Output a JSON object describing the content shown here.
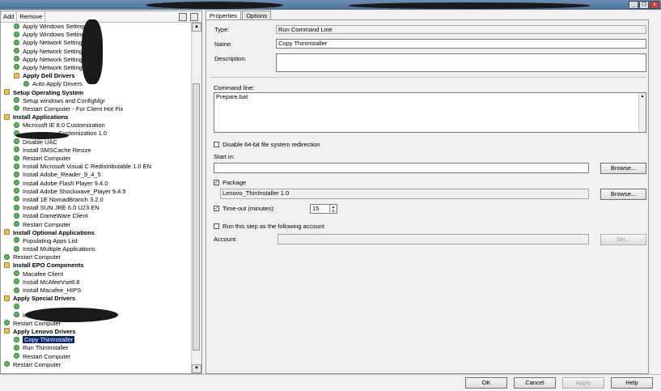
{
  "toolbar": {
    "add": "Add",
    "remove": "Remove"
  },
  "tree": [
    {
      "label": "Apply Windows Settings",
      "depth": 2,
      "kind": "check"
    },
    {
      "label": "Apply Windows Settings",
      "depth": 2,
      "kind": "check"
    },
    {
      "label": "Apply Network Settings",
      "depth": 2,
      "kind": "check"
    },
    {
      "label": "Apply Network Settings",
      "depth": 2,
      "kind": "check"
    },
    {
      "label": "Apply Network Settings",
      "depth": 2,
      "kind": "check"
    },
    {
      "label": "Apply Network Settings",
      "depth": 2,
      "kind": "check"
    },
    {
      "label": "Apply Dell Drivers",
      "depth": 2,
      "kind": "folder",
      "bold": true
    },
    {
      "label": "Auto Apply Drivers",
      "depth": 3,
      "kind": "check"
    },
    {
      "label": "Setup Operating System",
      "depth": 1,
      "kind": "folder",
      "bold": true
    },
    {
      "label": "Setup windows and ConfigMgr",
      "depth": 2,
      "kind": "check"
    },
    {
      "label": "Restart Computer - For Client Hot Fix",
      "depth": 2,
      "kind": "check"
    },
    {
      "label": "Install Applications",
      "depth": 1,
      "kind": "folder",
      "bold": true
    },
    {
      "label": "Microsoft IE 8.0 Customization",
      "depth": 2,
      "kind": "check"
    },
    {
      "label": "Customization 1.0",
      "depth": 2,
      "kind": "check",
      "redacted": true
    },
    {
      "label": "Disable UAC",
      "depth": 2,
      "kind": "check"
    },
    {
      "label": "Install SMSCache Resize",
      "depth": 2,
      "kind": "check"
    },
    {
      "label": "Restart Computer",
      "depth": 2,
      "kind": "check"
    },
    {
      "label": "Install Microsoft Visual C Redistributable 1.0 EN",
      "depth": 2,
      "kind": "check"
    },
    {
      "label": "Install Adobe_Reader_9_4_5",
      "depth": 2,
      "kind": "check"
    },
    {
      "label": "Install Adobe Flash Player 9.4.0",
      "depth": 2,
      "kind": "check"
    },
    {
      "label": "Install Adobe Shockwave_Player 9.4.5",
      "depth": 2,
      "kind": "check"
    },
    {
      "label": "Install 1E NomadBranch 3.2.0",
      "depth": 2,
      "kind": "check"
    },
    {
      "label": "Install SUN JRE 6.0 U23 EN",
      "depth": 2,
      "kind": "check"
    },
    {
      "label": "Install DameWare Client",
      "depth": 2,
      "kind": "check"
    },
    {
      "label": "Restart Computer",
      "depth": 2,
      "kind": "check"
    },
    {
      "label": "Install Optional Applications",
      "depth": 1,
      "kind": "folder",
      "bold": true
    },
    {
      "label": "Populating Apps List",
      "depth": 2,
      "kind": "check"
    },
    {
      "label": "Install Multiple Applications",
      "depth": 2,
      "kind": "check"
    },
    {
      "label": "Restart Computer",
      "depth": 1,
      "kind": "check"
    },
    {
      "label": "Install EPO Components",
      "depth": 1,
      "kind": "folder",
      "bold": true
    },
    {
      "label": "Macafee Client",
      "depth": 2,
      "kind": "check"
    },
    {
      "label": "Install McAfeeVse8.8",
      "depth": 2,
      "kind": "check"
    },
    {
      "label": "Install Macafee_HIPS",
      "depth": 2,
      "kind": "check"
    },
    {
      "label": "Apply Special Drivers",
      "depth": 1,
      "kind": "folder",
      "bold": true
    },
    {
      "label": "",
      "depth": 2,
      "kind": "check",
      "redacted": true
    },
    {
      "label": "Install Nvidia Quadro",
      "depth": 2,
      "kind": "check",
      "redacted": true
    },
    {
      "label": "Restart Computer",
      "depth": 1,
      "kind": "check"
    },
    {
      "label": "Apply Lenovo Drivers",
      "depth": 1,
      "kind": "folder",
      "bold": true
    },
    {
      "label": "Copy ThinInstaller",
      "depth": 2,
      "kind": "check",
      "selected": true
    },
    {
      "label": "Run ThinInstaller",
      "depth": 2,
      "kind": "check"
    },
    {
      "label": "Restart Computer",
      "depth": 2,
      "kind": "check"
    },
    {
      "label": "Restart Computer",
      "depth": 1,
      "kind": "check"
    }
  ],
  "tabs": {
    "properties": "Properties",
    "options": "Options"
  },
  "form": {
    "type_label": "Type:",
    "type_value": "Run Command Line",
    "name_label": "Name:",
    "name_value": "Copy ThinInstaller",
    "description_label": "Description:",
    "description_value": "",
    "command_label": "Command line:",
    "command_value": "Prepare.bat",
    "disable64_label": "Disable 64-bit file system redirection",
    "startin_label": "Start in:",
    "startin_value": "",
    "browse_label": "Browse...",
    "package_label": "Package",
    "package_value": "Lenovo_ThinInstaller 1.0",
    "timeout_label": "Time-out (minutes):",
    "timeout_value": "15",
    "runas_label": "Run this step as the following account",
    "account_label": "Account:",
    "account_value": "",
    "set_label": "Set..."
  },
  "footer": {
    "ok": "OK",
    "cancel": "Cancel",
    "apply": "Apply",
    "help": "Help"
  },
  "window": {
    "minimize": "_",
    "restore": "❐",
    "close": "x"
  }
}
